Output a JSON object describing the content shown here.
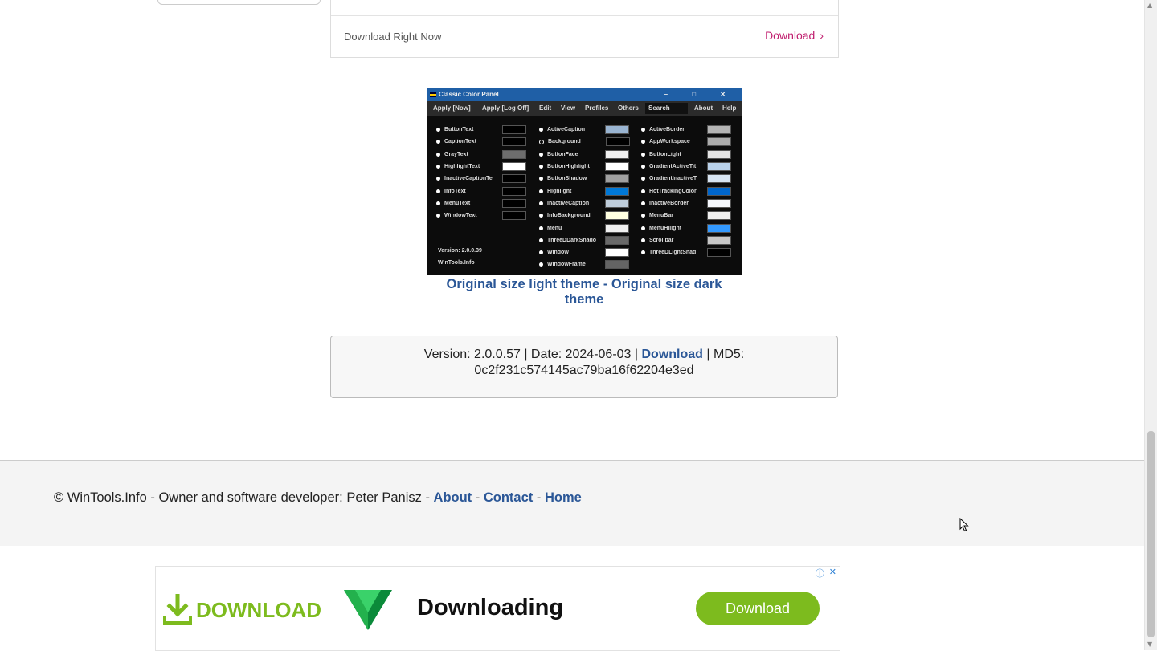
{
  "top_ad": {
    "left_text": "Download Right Now",
    "right_link": "Download",
    "right_chevron": "›"
  },
  "screenshot": {
    "title": "Classic Color Panel",
    "window_controls": "– □ ✕",
    "menu": [
      "Apply [Now]",
      "Apply [Log Off]",
      "Edit",
      "View",
      "Profiles",
      "Others",
      "Search",
      "About",
      "Help"
    ],
    "col1": [
      {
        "name": "ButtonText",
        "color": "#000000"
      },
      {
        "name": "CaptionText",
        "color": "#000000"
      },
      {
        "name": "GrayText",
        "color": "#6d6d6d"
      },
      {
        "name": "HighlightText",
        "color": "#ffffff"
      },
      {
        "name": "InactiveCaptionTe",
        "color": "#000000"
      },
      {
        "name": "InfoText",
        "color": "#000000"
      },
      {
        "name": "MenuText",
        "color": "#000000"
      },
      {
        "name": "WindowText",
        "color": "#000000"
      }
    ],
    "col2": [
      {
        "name": "ActiveCaption",
        "color": "#99b4d1"
      },
      {
        "name": "Background",
        "color": "#000000"
      },
      {
        "name": "ButtonFace",
        "color": "#f0f0f0"
      },
      {
        "name": "ButtonHighlight",
        "color": "#ffffff"
      },
      {
        "name": "ButtonShadow",
        "color": "#a0a0a0"
      },
      {
        "name": "Highlight",
        "color": "#0078d7"
      },
      {
        "name": "InactiveCaption",
        "color": "#bfcddb"
      },
      {
        "name": "InfoBackground",
        "color": "#ffffe1"
      },
      {
        "name": "Menu",
        "color": "#f0f0f0"
      },
      {
        "name": "ThreeDDarkShado",
        "color": "#696969"
      },
      {
        "name": "Window",
        "color": "#ffffff"
      },
      {
        "name": "WindowFrame",
        "color": "#646464"
      }
    ],
    "col3": [
      {
        "name": "ActiveBorder",
        "color": "#b4b4b4"
      },
      {
        "name": "AppWorkspace",
        "color": "#ababab"
      },
      {
        "name": "ButtonLight",
        "color": "#e3e3e3"
      },
      {
        "name": "GradientActiveTit",
        "color": "#b9d1ea"
      },
      {
        "name": "GradientInactiveT",
        "color": "#d7e4f2"
      },
      {
        "name": "HotTrackingColor",
        "color": "#0066cc"
      },
      {
        "name": "InactiveBorder",
        "color": "#f4f7fc"
      },
      {
        "name": "MenuBar",
        "color": "#f0f0f0"
      },
      {
        "name": "MenuHilight",
        "color": "#3399ff"
      },
      {
        "name": "Scrollbar",
        "color": "#c8c8c8"
      },
      {
        "name": "ThreeDLightShad",
        "color": "#000000"
      }
    ],
    "version_text": "Version: 2.0.0.39",
    "site_text": "WinTools.Info"
  },
  "caption": {
    "light": "Original size light theme",
    "sep": " - ",
    "dark": "Original size dark theme"
  },
  "version_box": {
    "prefix": "Version: 2.0.0.57 | Date: 2024-06-03 | ",
    "download": "Download",
    "suffix": " | MD5:",
    "md5": "0c2f231c574145ac79ba16f62204e3ed"
  },
  "footer": {
    "copyright": "© WinTools.Info - Owner and software developer: Peter Panisz - ",
    "about": "About",
    "sep1": " - ",
    "contact": "Contact",
    "sep2": " - ",
    "home": "Home"
  },
  "bottom_ad": {
    "left_label": "DOWNLOAD",
    "headline": "Downloading",
    "button": "Download",
    "info_icon": "ⓘ",
    "close_icon": "✕",
    "accent": "#7dbb1e"
  },
  "colors": {
    "link": "#2b5797",
    "ad_link": "#c01d6e"
  }
}
